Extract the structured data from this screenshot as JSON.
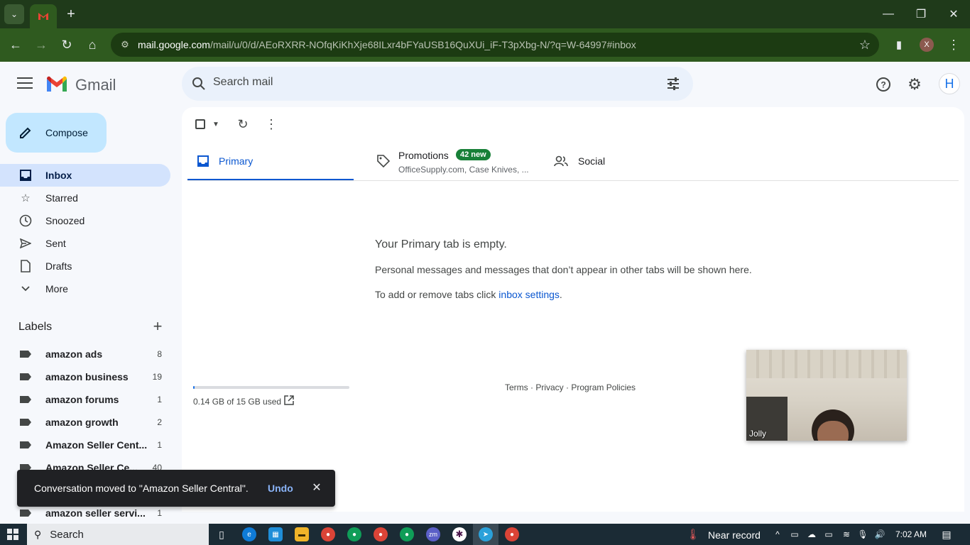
{
  "browser": {
    "url_host": "mail.google.com",
    "url_path": "/mail/u/0/d/AEoRXRR-NOfqKiKhXje68ILxr4bFYaUSB16QuXUi_iF-T3pXbg-N/?q=W-64997#inbox",
    "profile_initial": "X"
  },
  "header": {
    "app_name": "Gmail",
    "search_placeholder": "Search mail",
    "account_initial": "H"
  },
  "sidebar": {
    "compose_label": "Compose",
    "items": [
      {
        "label": "Inbox",
        "icon": "inbox-icon"
      },
      {
        "label": "Starred",
        "icon": "star-icon"
      },
      {
        "label": "Snoozed",
        "icon": "clock-icon"
      },
      {
        "label": "Sent",
        "icon": "send-icon"
      },
      {
        "label": "Drafts",
        "icon": "draft-icon"
      },
      {
        "label": "More",
        "icon": "chevron-down-icon"
      }
    ],
    "labels_title": "Labels",
    "labels": [
      {
        "name": "amazon ads",
        "count": "8"
      },
      {
        "name": "amazon business",
        "count": "19"
      },
      {
        "name": "amazon forums",
        "count": "1"
      },
      {
        "name": "amazon growth",
        "count": "2"
      },
      {
        "name": "Amazon Seller Cent...",
        "count": "1"
      },
      {
        "name": "Amazon Seller Ce...",
        "count": "40"
      },
      {
        "name": "amazon seller servi...",
        "count": "1"
      }
    ]
  },
  "tabs": {
    "primary": "Primary",
    "promotions": "Promotions",
    "promotions_badge": "42 new",
    "promotions_senders": "OfficeSupply.com, Case Knives, ...",
    "social": "Social"
  },
  "empty_state": {
    "title": "Your Primary tab is empty.",
    "description": "Personal messages and messages that don’t appear in other tabs will be shown here.",
    "tip_prefix": "To add or remove tabs click ",
    "tip_link": "inbox settings",
    "tip_suffix": "."
  },
  "storage": {
    "text": "0.14 GB of 15 GB used",
    "used_fraction": 0.01
  },
  "footer": {
    "terms": "Terms",
    "privacy": "Privacy",
    "policies": "Program Policies",
    "separator": " · "
  },
  "video": {
    "participant_name": "Jolly"
  },
  "snackbar": {
    "message": "Conversation moved to \"Amazon Seller Central\".",
    "action": "Undo"
  },
  "taskbar": {
    "search_label": "Search",
    "weather": "Near record",
    "time": "7:02 AM"
  },
  "colors": {
    "accent": "#0b57d0",
    "compose_bg": "#c2e7ff",
    "badge_green": "#188038"
  }
}
